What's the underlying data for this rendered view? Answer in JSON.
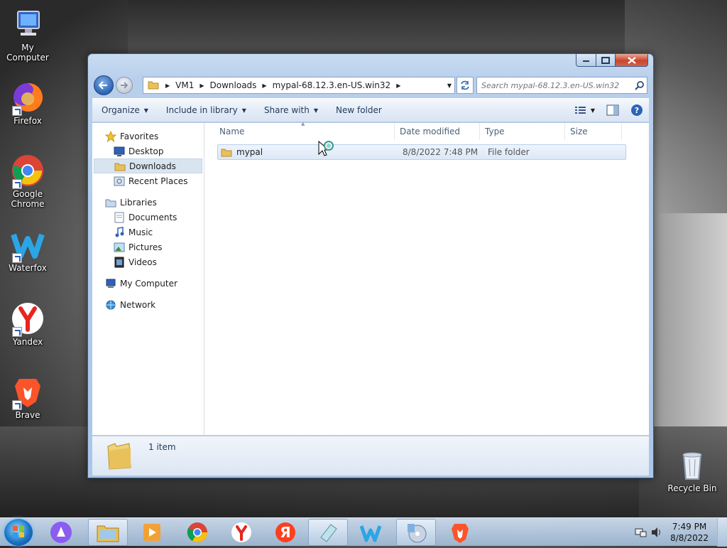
{
  "desktop": {
    "icons": [
      {
        "label": "My Computer",
        "icon": "my-computer-icon"
      },
      {
        "label": "Firefox",
        "icon": "firefox-icon"
      },
      {
        "label": "Google Chrome",
        "icon": "chrome-icon"
      },
      {
        "label": "Waterfox",
        "icon": "waterfox-icon"
      },
      {
        "label": "Yandex",
        "icon": "yandex-icon"
      },
      {
        "label": "Brave",
        "icon": "brave-icon"
      },
      {
        "label": "Recycle Bin",
        "icon": "recycle-bin-icon"
      }
    ]
  },
  "window": {
    "title": "",
    "breadcrumb": [
      "VM1",
      "Downloads",
      "mypal-68.12.3.en-US.win32"
    ],
    "search_placeholder": "Search mypal-68.12.3.en-US.win32",
    "toolbar": {
      "organize": "Organize",
      "include_in_library": "Include in library",
      "share_with": "Share with",
      "new_folder": "New folder"
    },
    "nav": {
      "favorites": {
        "label": "Favorites",
        "items": [
          "Desktop",
          "Downloads",
          "Recent Places"
        ]
      },
      "libraries": {
        "label": "Libraries",
        "items": [
          "Documents",
          "Music",
          "Pictures",
          "Videos"
        ]
      },
      "computer": "My Computer",
      "network": "Network",
      "selected": "Downloads"
    },
    "columns": {
      "name": "Name",
      "date_modified": "Date modified",
      "type": "Type",
      "size": "Size"
    },
    "files": [
      {
        "name": "mypal",
        "date_modified": "8/8/2022 7:48 PM",
        "type": "File folder",
        "size": ""
      }
    ],
    "status": {
      "item_count": "1 item"
    }
  },
  "taskbar": {
    "apps": [
      "Alice",
      "File Explorer",
      "Media Player",
      "Google Chrome",
      "Yandex Browser",
      "Yandex",
      "Notepad",
      "Waterfox",
      "Disc Utility",
      "Brave"
    ],
    "clock": {
      "time": "7:49 PM",
      "date": "8/8/2022"
    }
  },
  "colors": {
    "accent": "#2a63b2",
    "selection": "#dce8f7",
    "toolbar_text": "#1e395b"
  }
}
